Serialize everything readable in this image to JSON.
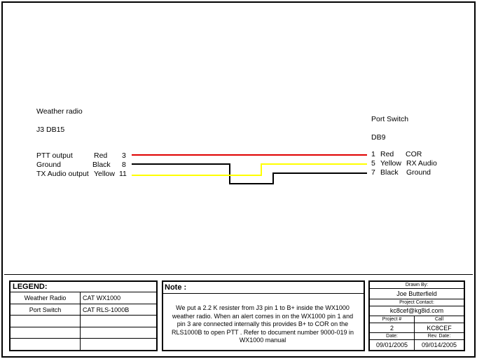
{
  "source": {
    "name": "Weather radio",
    "connector": "J3 DB15",
    "pins": [
      {
        "label": "PTT output",
        "color": "Red",
        "pin": "3"
      },
      {
        "label": "Ground",
        "color": "Black",
        "pin": "8"
      },
      {
        "label": "TX Audio output",
        "color": "Yellow",
        "pin": "11"
      }
    ]
  },
  "dest": {
    "name": "Port Switch",
    "connector": "DB9",
    "pins": [
      {
        "pin": "1",
        "color": "Red",
        "signal": "COR"
      },
      {
        "pin": "5",
        "color": "Yellow",
        "signal": "RX Audio"
      },
      {
        "pin": "7",
        "color": "Black",
        "signal": "Ground"
      }
    ]
  },
  "wire_colors": {
    "red": "#e00000",
    "yellow": "#ffff00",
    "black": "#000000"
  },
  "legend": {
    "title": "LEGEND:",
    "rows": [
      {
        "name": "Weather Radio",
        "value": "CAT WX1000"
      },
      {
        "name": "Port Switch",
        "value": "CAT RLS-1000B"
      },
      {
        "name": "",
        "value": ""
      },
      {
        "name": "",
        "value": ""
      },
      {
        "name": "",
        "value": ""
      }
    ]
  },
  "note": {
    "title": "Note :",
    "text": "We put a 2.2 K resister from J3 pin 1 to B+ inside the WX1000 weather radio. When an alert comes in on the WX1000 pin 1 and pin 3 are connected internally this provides B+ to COR on the RLS1000B to open PTT . Refer to document number 9000-019 in WX1000 manual"
  },
  "title_block": {
    "drawn_by_label": "Drawn By:",
    "drawn_by": "Joe Butterfield",
    "contact_label": "Project Contact:",
    "contact": "kc8cef@kg8id.com",
    "project_label": "Project #",
    "project": "2",
    "call_label": "Call",
    "call": "KC8CEF",
    "date_label": "Date:",
    "date": "09/01/2005",
    "rev_label": "Rev. Date:",
    "rev_date": "09/014/2005"
  }
}
